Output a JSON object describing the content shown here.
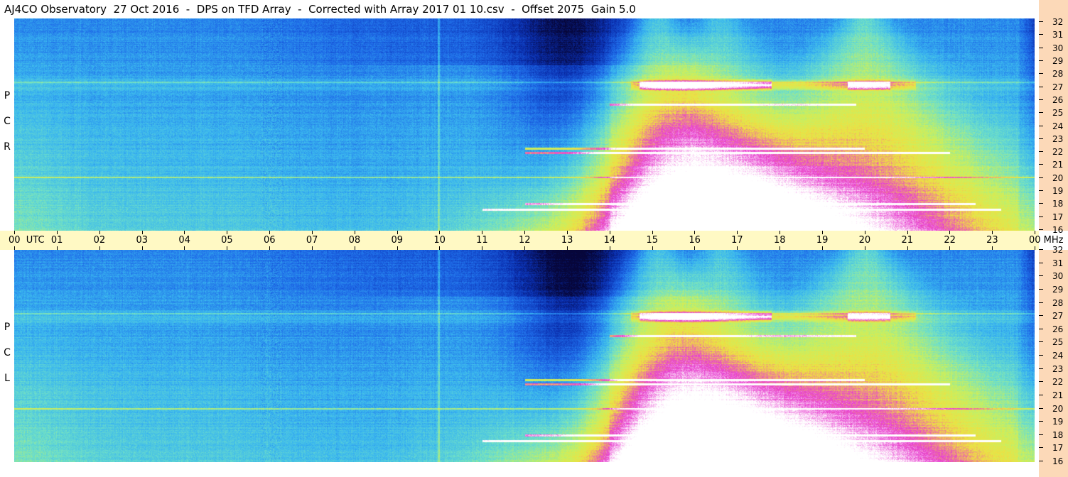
{
  "title": "AJ4CO Observatory  27 Oct 2016  -  DPS on TFD Array  -  Corrected with Array 2017 01 10.csv  -  Offset 2075  Gain 5.0",
  "chart_data": {
    "type": "heatmap",
    "title": "AJ4CO Observatory  27 Oct 2016  -  DPS on TFD Array  -  Corrected with Array 2017 01 10.csv  -  Offset 2075  Gain 5.0",
    "x_axis": {
      "unit": "UTC",
      "range": [
        0,
        24
      ],
      "tick_labels": [
        "00",
        "01",
        "02",
        "03",
        "04",
        "05",
        "06",
        "07",
        "08",
        "09",
        "10",
        "11",
        "12",
        "13",
        "14",
        "15",
        "16",
        "17",
        "18",
        "19",
        "20",
        "21",
        "22",
        "23",
        "00"
      ],
      "first_label": "00  UTC",
      "last_label": "00 MHz"
    },
    "y_axis": {
      "unit": "MHz",
      "range": [
        16,
        32
      ],
      "tick_labels": [
        "32",
        "31",
        "30",
        "29",
        "28",
        "27",
        "26",
        "25",
        "24",
        "23",
        "22",
        "21",
        "20",
        "19",
        "18",
        "17",
        "16"
      ]
    },
    "panels": [
      {
        "name": "RCP",
        "label_letters": [
          "R",
          "C",
          "P"
        ]
      },
      {
        "name": "LCP",
        "label_letters": [
          "L",
          "C",
          "P"
        ]
      }
    ],
    "colormap": [
      "#06063a",
      "#0a2fb0",
      "#1e6ae8",
      "#39b6f0",
      "#6fe0c8",
      "#c8f060",
      "#f0e040",
      "#e83cd0",
      "#ffffff"
    ],
    "features": {
      "dark_region_utc": [
        11.5,
        14.5
      ],
      "emission_peaks_utc": [
        15.1,
        16.6,
        20.0
      ],
      "bright_band_mhz": 27,
      "persistent_lines_mhz": [
        17.6,
        18,
        20,
        22,
        27.2
      ]
    }
  },
  "colors": {
    "time_axis_bg": "#fff9c4",
    "freq_axis_bg": "#fcd9b8"
  }
}
